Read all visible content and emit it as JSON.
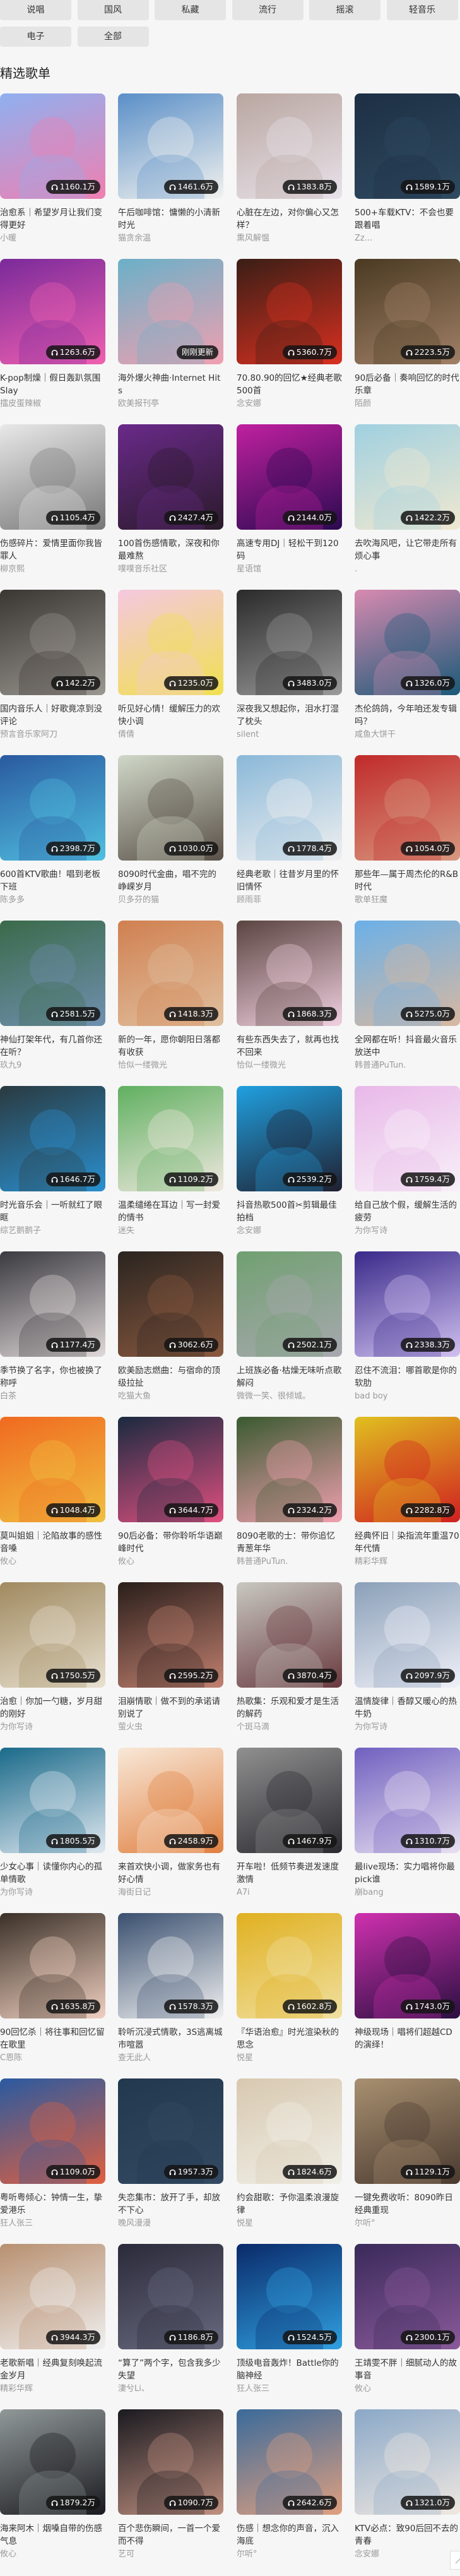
{
  "tags": [
    "说唱",
    "国风",
    "私藏",
    "流行",
    "摇滚",
    "轻音乐",
    "电子",
    "全部"
  ],
  "section_title": "精选歌单",
  "cards": [
    {
      "count": "1160.1万",
      "title": "治愈系｜希望岁月让我们变得更好",
      "author": "小暖",
      "colors": [
        "#8fb0f0",
        "#f07fb0"
      ]
    },
    {
      "count": "1461.6万",
      "title": "午后咖啡馆：慵懒的小清新时光",
      "author": "猫贪余温",
      "colors": [
        "#5a8fc8",
        "#f2f2ee"
      ]
    },
    {
      "count": "1383.8万",
      "title": "心脏在左边，对你偏心又怎样？",
      "author": "熏风解愠",
      "colors": [
        "#b9a6a0",
        "#e8e2ea"
      ]
    },
    {
      "count": "1589.1万",
      "title": "500+车载KTV：不会也要跟着唱",
      "author": "Zz...",
      "colors": [
        "#1d2f44",
        "#2f4a60"
      ]
    },
    {
      "count": "1263.6万",
      "title": "K-pop制燥｜假日轰趴氛围Slay",
      "author": "擂皮蛋辣椒",
      "colors": [
        "#7a2a9a",
        "#f060b0"
      ]
    },
    {
      "count": "刚刚更新",
      "title": "海外爆火神曲·Internet Hits",
      "author": "欧美报刊亭",
      "colors": [
        "#6ab0c8",
        "#f0a0b0"
      ]
    },
    {
      "count": "5360.7万",
      "title": "70.80.90的回忆★经典老歌500首",
      "author": "念安娜",
      "colors": [
        "#3a1e16",
        "#d83020"
      ]
    },
    {
      "count": "2223.5万",
      "title": "90后必备｜奏响回忆的时代乐章",
      "author": "陌颜",
      "colors": [
        "#4a3a22",
        "#a08066"
      ]
    },
    {
      "count": "1105.4万",
      "title": "伤感碎片：爱情里面你我皆罪人",
      "author": "柳京熙",
      "colors": [
        "#e8e8e8",
        "#777777"
      ]
    },
    {
      "count": "2427.4万",
      "title": "100首伤感情歌，深夜和你最难熬",
      "author": "噗噗音乐社区",
      "colors": [
        "#6a2a8a",
        "#2a1a2a"
      ]
    },
    {
      "count": "2144.0万",
      "title": "高速专用DJ｜轻松干到120码",
      "author": "星语馆",
      "colors": [
        "#c020a0",
        "#2a0a50"
      ]
    },
    {
      "count": "1422.2万",
      "title": "去吹海风吧，让它带走所有烦心事",
      "author": ".",
      "colors": [
        "#9fd0e0",
        "#f0e8d0"
      ]
    },
    {
      "count": "142.2万",
      "title": "国内音乐人｜好歌竟凉到没评论",
      "author": "预言音乐家阿刀",
      "colors": [
        "#3a3632",
        "#9a9690"
      ]
    },
    {
      "count": "1235.0万",
      "title": "听见好心情！缓解压力的欢快小调",
      "author": "倩倩",
      "colors": [
        "#f4c8e0",
        "#f0e050"
      ]
    },
    {
      "count": "3483.0万",
      "title": "深夜我又想起你，泪水打湿了枕头",
      "author": "silent",
      "colors": [
        "#2a2a2a",
        "#9a9a9a"
      ]
    },
    {
      "count": "1326.0万",
      "title": "杰伦鸽鸽，今年咱还发专辑吗？",
      "author": "咸鱼大饼干",
      "colors": [
        "#d88ab0",
        "#1a5a78"
      ]
    },
    {
      "count": "2398.7万",
      "title": "600首KTV歌曲！唱到老板下班",
      "author": "陈多多",
      "colors": [
        "#2a5aa0",
        "#50c0e0"
      ]
    },
    {
      "count": "1030.0万",
      "title": "8090时代金曲，唱不完的峥嵘岁月",
      "author": "贝多芬的猫",
      "colors": [
        "#d0d8c8",
        "#5a5048"
      ]
    },
    {
      "count": "1778.4万",
      "title": "经典老歌｜往昔岁月里的怀旧情怀",
      "author": "顾雨菲",
      "colors": [
        "#8ab8d8",
        "#f0f0f0"
      ]
    },
    {
      "count": "1054.0万",
      "title": "那些年—属于周杰伦的R&B时代",
      "author": "歌单狂魔",
      "colors": [
        "#c02a2a",
        "#d89880"
      ]
    },
    {
      "count": "2581.5万",
      "title": "神仙打架年代，有几首你还在听？",
      "author": "玖九9",
      "colors": [
        "#3a6a4a",
        "#7090b0"
      ]
    },
    {
      "count": "1418.3万",
      "title": "新的一年，愿你朝阳日落都有收获",
      "author": "恰似一缕微光",
      "colors": [
        "#d08050",
        "#e0c0a0"
      ]
    },
    {
      "count": "1868.3万",
      "title": "有些东西失去了，就再也找不回来",
      "author": "恰似一缕微光",
      "colors": [
        "#5a4440",
        "#f0d0e0"
      ]
    },
    {
      "count": "5275.0万",
      "title": "全网都在听！抖音最火音乐放送中",
      "author": "韩普通PuTun.",
      "colors": [
        "#6ab0e8",
        "#d8b8a0"
      ]
    },
    {
      "count": "1646.7万",
      "title": "时光音乐会｜一听就红了眼眶",
      "author": "综艺鹅鹅子",
      "colors": [
        "#2a3a40",
        "#2a90d0"
      ]
    },
    {
      "count": "1109.2万",
      "title": "温柔缱绻在耳边｜写一封爱的情书",
      "author": "迷失",
      "colors": [
        "#60b060",
        "#f0e8e0"
      ]
    },
    {
      "count": "2539.2万",
      "title": "抖音热歌500首✂剪辑最佳拍档",
      "author": "念安娜",
      "colors": [
        "#20a0e0",
        "#202030"
      ]
    },
    {
      "count": "1759.4万",
      "title": "给自己放个假，缓解生活的疲劳",
      "author": "为你写诗",
      "colors": [
        "#e8b8e8",
        "#f8f0f8"
      ]
    },
    {
      "count": "1177.4万",
      "title": "季节换了名字，你也被换了称呼",
      "author": "白茶",
      "colors": [
        "#3a3a40",
        "#e0d8d8"
      ]
    },
    {
      "count": "3062.6万",
      "title": "欧美励志燃曲：与宿命的顶级拉扯",
      "author": "吃猫大鱼",
      "colors": [
        "#2a2420",
        "#8a5a40"
      ]
    },
    {
      "count": "2502.1万",
      "title": "上班族必备·枯燥无味听点歌解闷",
      "author": "微微一笑、很倾城。",
      "colors": [
        "#70a070",
        "#a8a8b0"
      ]
    },
    {
      "count": "2338.3万",
      "title": "忍住不流泪：哪首歌是你的软肋",
      "author": "bad boy",
      "colors": [
        "#3a2a8a",
        "#d0c0f0"
      ]
    },
    {
      "count": "1048.4万",
      "title": "莫叫姐姐｜沦陷故事的感性音嗓",
      "author": "攸心",
      "colors": [
        "#f06a20",
        "#f0c040"
      ]
    },
    {
      "count": "3644.7万",
      "title": "90后必备：带你聆听华语巅峰时代",
      "author": "攸心",
      "colors": [
        "#1a2a40",
        "#e05080"
      ]
    },
    {
      "count": "2324.2万",
      "title": "8090老歌的士：带你追忆青葱年华",
      "author": "韩普通PuTun.",
      "colors": [
        "#3a5a30",
        "#f0a0b0"
      ]
    },
    {
      "count": "2282.8万",
      "title": "经典怀旧｜染指流年重温70年代情",
      "author": "精彩华辉",
      "colors": [
        "#e0c020",
        "#d02020"
      ]
    },
    {
      "count": "1750.5万",
      "title": "治愈｜你加一勺糖，岁月甜的刚好",
      "author": "为你写诗",
      "colors": [
        "#a08a60",
        "#e8e0d0"
      ]
    },
    {
      "count": "2595.2万",
      "title": "泪崩情歌｜做不到的承诺请别说了",
      "author": "萤火虫",
      "colors": [
        "#2a1e1a",
        "#c08070"
      ]
    },
    {
      "count": "3870.4万",
      "title": "热歌集：乐观和爱才是生活的解药",
      "author": "个斑马滴",
      "colors": [
        "#c8c8c0",
        "#6a3a40"
      ]
    },
    {
      "count": "2097.9万",
      "title": "温情旋律｜香醇又暖心的热牛奶",
      "author": "为你写诗",
      "colors": [
        "#8aa0b8",
        "#f0f0f8"
      ]
    },
    {
      "count": "1805.5万",
      "title": "少女心事｜读懂你内心的孤单情歌",
      "author": "为你写诗",
      "colors": [
        "#1a6a8a",
        "#e0e8f0"
      ]
    },
    {
      "count": "2458.9万",
      "title": "来首欢快小调，做家务也有好心情",
      "author": "海街日记",
      "colors": [
        "#f8e8d8",
        "#e08040"
      ]
    },
    {
      "count": "1467.9万",
      "title": "开车啦！低频节奏迸发速度激情",
      "author": "A7i",
      "colors": [
        "#909090",
        "#2a2a30"
      ]
    },
    {
      "count": "1310.7万",
      "title": "最live现场：实力唱将你最pick谁",
      "author": "崩bang",
      "colors": [
        "#7060c0",
        "#e8e0f0"
      ]
    },
    {
      "count": "1635.8万",
      "title": "90回忆杀｜将往事和回忆留在歌里",
      "author": "C恩陈",
      "colors": [
        "#3a3028",
        "#f0d0c0"
      ]
    },
    {
      "count": "1578.3万",
      "title": "聆听沉浸式情歌，3S逃离城市喧嚣",
      "author": "查无此人",
      "colors": [
        "#3a5070",
        "#f0f0f0"
      ]
    },
    {
      "count": "1602.8万",
      "title": "『华语治愈』时光渲染秋的思念",
      "author": "悦星",
      "colors": [
        "#e0b020",
        "#f0e0a0"
      ]
    },
    {
      "count": "1743.0万",
      "title": "神级现场｜唱将们超越CD的演绎！",
      "author": "",
      "colors": [
        "#d030b0",
        "#2a1040"
      ]
    },
    {
      "count": "1109.0万",
      "title": "粤听粤倾心：钟情一生，挚爱港乐",
      "author": "狂人张三",
      "colors": [
        "#2a5aa0",
        "#e06040"
      ]
    },
    {
      "count": "1957.3万",
      "title": "失恋集市：放开了手，却放不下心",
      "author": "晚风漫漫",
      "colors": [
        "#22384e",
        "#344a62"
      ]
    },
    {
      "count": "1824.6万",
      "title": "约会甜歌：予你温柔浪漫旋律",
      "author": "悦星",
      "colors": [
        "#d8c8b0",
        "#f0f0e8"
      ]
    },
    {
      "count": "1129.1万",
      "title": "一键免费收听：8090昨日经典重现",
      "author": "尔听°",
      "colors": [
        "#a89070",
        "#4a3a30"
      ]
    },
    {
      "count": "3944.3万",
      "title": "老歌新唱｜经典复刻唤起流金岁月",
      "author": "精彩华辉",
      "colors": [
        "#b89070",
        "#f0f0f0"
      ]
    },
    {
      "count": "1186.8万",
      "title": "“算了”两个字，包含我多少失望",
      "author": "淒兮Li、",
      "colors": [
        "#2a2a3a",
        "#6a6a80"
      ]
    },
    {
      "count": "1524.5万",
      "title": "顶级电音轰炸！Battle你的脑神经",
      "author": "狂人张三",
      "colors": [
        "#0a2a6a",
        "#30a0e0"
      ]
    },
    {
      "count": "2300.1万",
      "title": "王靖雯不胖｜细腻动人的故事音",
      "author": "攸心",
      "colors": [
        "#3a2a5a",
        "#8a5a9a"
      ]
    },
    {
      "count": "1879.2万",
      "title": "海来阿木｜烟嗓自带的伤感气息",
      "author": "攸心",
      "colors": [
        "#909898",
        "#1a1a20"
      ]
    },
    {
      "count": "1090.7万",
      "title": "百个悲伤瞬间，一首一个爱而不得",
      "author": "艺可",
      "colors": [
        "#1a1a20",
        "#c09080"
      ]
    },
    {
      "count": "2642.6万",
      "title": "伤感｜想念你的声音，沉入海底",
      "author": "尔听°",
      "colors": [
        "#3a6a9a",
        "#e0a080"
      ]
    },
    {
      "count": "1321.0万",
      "title": "KTV必点：致90后回不去的青春",
      "author": "念安娜",
      "colors": [
        "#8aa8c8",
        "#f0e8e0"
      ]
    }
  ],
  "icons": {
    "play_count": "headphones-icon",
    "back_to_top": "arrow-up-icon"
  }
}
